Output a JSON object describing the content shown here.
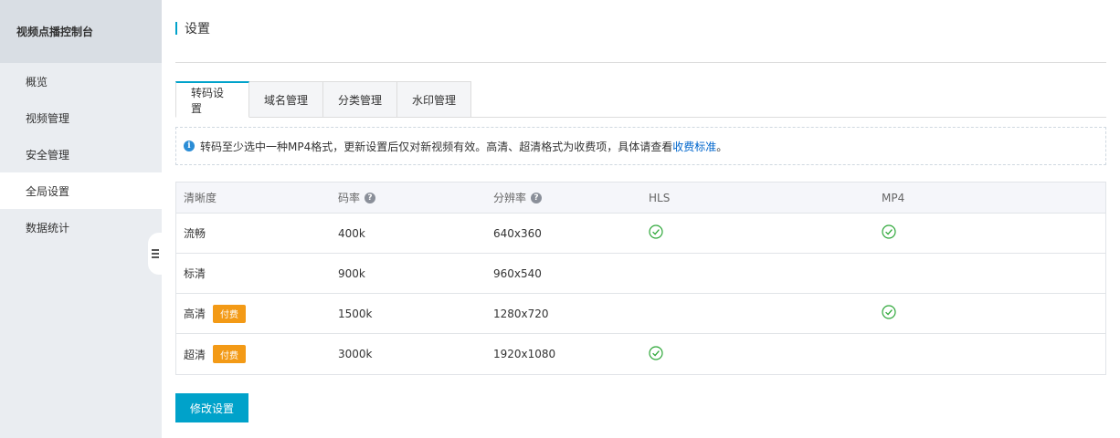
{
  "sidebar": {
    "title": "视频点播控制台",
    "items": [
      {
        "label": "概览"
      },
      {
        "label": "视频管理"
      },
      {
        "label": "安全管理"
      },
      {
        "label": "全局设置"
      },
      {
        "label": "数据统计"
      }
    ],
    "active_index": 3
  },
  "page": {
    "title": "设置"
  },
  "tabs": [
    {
      "label": "转码设置"
    },
    {
      "label": "域名管理"
    },
    {
      "label": "分类管理"
    },
    {
      "label": "水印管理"
    }
  ],
  "notice": {
    "icon": "info-icon",
    "text": "转码至少选中一种MP4格式，更新设置后仅对新视频有效。高清、超清格式为收费项，具体请查看",
    "link": "收费标准",
    "suffix": "。"
  },
  "table": {
    "headers": [
      "清晰度",
      "码率",
      "分辨率",
      "HLS",
      "MP4"
    ],
    "rows": [
      {
        "quality": "流畅",
        "paid": false,
        "bitrate": "400k",
        "resolution": "640x360",
        "hls": true,
        "mp4": true
      },
      {
        "quality": "标清",
        "paid": false,
        "bitrate": "900k",
        "resolution": "960x540",
        "hls": false,
        "mp4": false
      },
      {
        "quality": "高清",
        "paid": true,
        "bitrate": "1500k",
        "resolution": "1280x720",
        "hls": false,
        "mp4": true
      },
      {
        "quality": "超清",
        "paid": true,
        "bitrate": "3000k",
        "resolution": "1920x1080",
        "hls": true,
        "mp4": false
      }
    ],
    "paid_badge": "付费"
  },
  "submit_label": "修改设置",
  "colors": {
    "accent": "#00a2ca",
    "badge": "#f39a16",
    "check": "#2fa83a",
    "link": "#0066cc"
  }
}
